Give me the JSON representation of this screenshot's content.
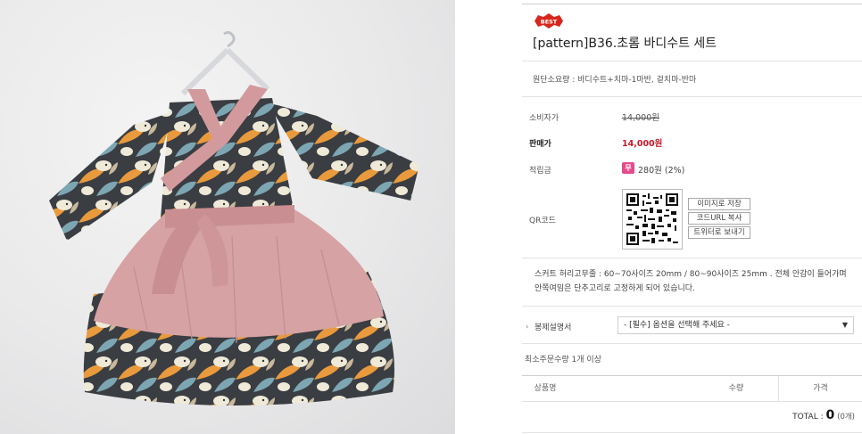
{
  "product_image": {
    "alt": ""
  },
  "badge": {
    "label": "BEST",
    "color": "#d9261c"
  },
  "product": {
    "title": "[pattern]B36.초롬 바디수트 세트",
    "fabric": "원단소요량 : 바디수트+치마-1마반, 겉치마-반마"
  },
  "price": {
    "consumer_label": "소비자가",
    "consumer_value": "14,000원",
    "sale_label": "판매가",
    "sale_value": "14,000원",
    "sale_color": "#c8172a",
    "points_label": "적립금",
    "points_icon": "무",
    "points_value": "280원 (2%)"
  },
  "qr": {
    "label": "QR코드",
    "buttons": [
      "이미지로 저장",
      "코드URL 복사",
      "트위터로 보내기"
    ]
  },
  "description": "스커트 허리고무줄 : 60~70사이즈 20mm / 80~90사이즈 25mm . 전체 안감이 들어가며 안쪽여밈은 단추고리로 고정하게 되어 있습니다.",
  "option": {
    "bullet": "›",
    "label": "봉제설명서",
    "selected": "- [필수] 옵션을 선택해 주세요 -",
    "arrow": "▼"
  },
  "min_order": "최소주문수량 1개 이상",
  "table": {
    "headers": [
      "상품명",
      "수량",
      "가격"
    ]
  },
  "total": {
    "label": "TOTAL",
    "separator": " : ",
    "amount": "0",
    "count": "(0개)"
  }
}
